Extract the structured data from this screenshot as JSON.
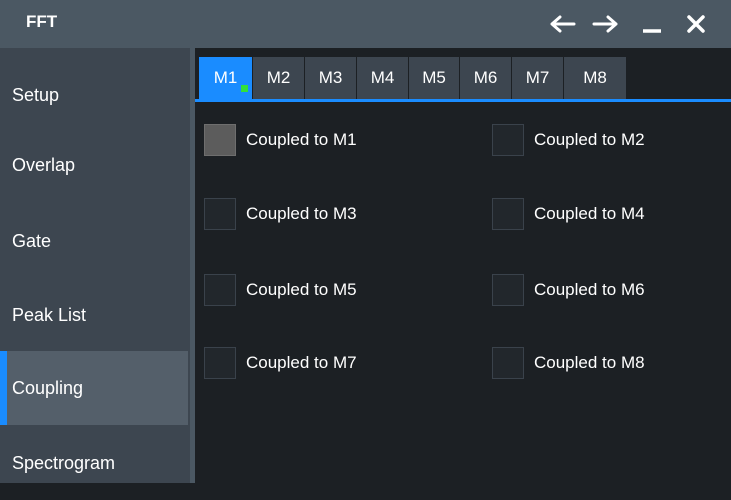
{
  "window": {
    "title": "FFT",
    "controls": [
      {
        "name": "back-arrow-icon",
        "glyph": "←"
      },
      {
        "name": "forward-arrow-icon",
        "glyph": "→"
      },
      {
        "name": "minimize-icon",
        "glyph": "_"
      },
      {
        "name": "close-icon",
        "glyph": "✕"
      }
    ]
  },
  "sidebar": {
    "items": [
      {
        "label": "Setup",
        "active": false
      },
      {
        "label": "Overlap",
        "active": false
      },
      {
        "label": "Gate",
        "active": false
      },
      {
        "label": "Peak List",
        "active": false
      },
      {
        "label": "Coupling",
        "active": true
      },
      {
        "label": "Spectrogram",
        "active": false
      }
    ]
  },
  "tabs": {
    "items": [
      "M1",
      "M2",
      "M3",
      "M4",
      "M5",
      "M6",
      "M7",
      "M8"
    ],
    "active": "M1",
    "active_indicator_color": "#33e03a"
  },
  "coupling": {
    "options": [
      {
        "label": "Coupled to M1",
        "checked": true
      },
      {
        "label": "Coupled to M2",
        "checked": false
      },
      {
        "label": "Coupled to M3",
        "checked": false
      },
      {
        "label": "Coupled to M4",
        "checked": false
      },
      {
        "label": "Coupled to M5",
        "checked": false
      },
      {
        "label": "Coupled to M6",
        "checked": false
      },
      {
        "label": "Coupled to M7",
        "checked": false
      },
      {
        "label": "Coupled to M8",
        "checked": false
      }
    ]
  },
  "colors": {
    "accent": "#1a8cff",
    "titlebar": "#4b5863",
    "sidebar": "#3d4650",
    "background": "#1c2024"
  }
}
